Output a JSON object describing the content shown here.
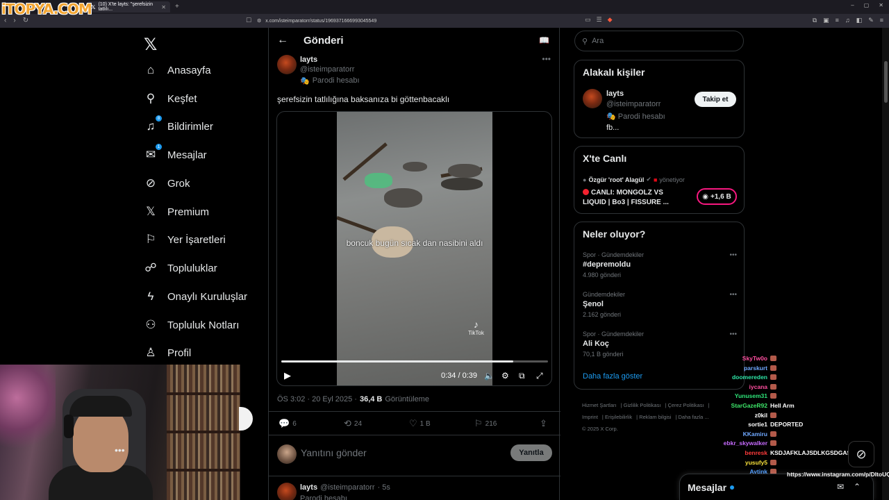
{
  "browser": {
    "logo_text": "iTOPYA.COM",
    "tab_title": "(10) X'te layts: \"şerefsizin tatlılı...",
    "url": "x.com/isteimparatorr/status/1969371666993045549"
  },
  "sidebar": {
    "items": [
      {
        "label": "Anasayfa",
        "icon": "home-icon"
      },
      {
        "label": "Keşfet",
        "icon": "search-icon"
      },
      {
        "label": "Bildirimler",
        "icon": "bell-icon",
        "badge": "8"
      },
      {
        "label": "Mesajlar",
        "icon": "mail-icon",
        "badge": "1"
      },
      {
        "label": "Grok",
        "icon": "grok-icon"
      },
      {
        "label": "Premium",
        "icon": "x-icon"
      },
      {
        "label": "Yer İşaretleri",
        "icon": "bookmark-icon"
      },
      {
        "label": "Topluluklar",
        "icon": "people-icon"
      },
      {
        "label": "Onaylı Kuruluşlar",
        "icon": "lightning-icon"
      },
      {
        "label": "Topluluk Notları",
        "icon": "notes-icon"
      },
      {
        "label": "Profil",
        "icon": "person-icon"
      }
    ]
  },
  "main": {
    "header_title": "Gönderi",
    "post": {
      "author": "layts",
      "handle": "@isteimparatorr",
      "parody": "Parodi hesabı",
      "text": "şerefsizin tatlılığına baksanıza bi göttenbacaklı",
      "video_caption": "boncuk bugün sıcak dan nasibini aldı",
      "tiktok_label": "TikTok",
      "time_current": "0:34",
      "time_total": "0:39",
      "progress": 0.87,
      "timestamp": "ÖS 3:02 · 20 Eyl 2025 ·",
      "views": "36,4 B",
      "views_label": "Görüntüleme",
      "replies": "6",
      "reposts": "24",
      "likes": "1 B",
      "bookmarks": "216"
    },
    "reply_placeholder": "Yanıtını gönder",
    "reply_button": "Yanıtla",
    "next_post": {
      "author": "layts",
      "handle": "@isteimparatorr",
      "time": "· 5s",
      "parody": "Parodi hesabı"
    }
  },
  "right": {
    "search_placeholder": "Ara",
    "related": {
      "title": "Alakalı kişiler",
      "name": "layts",
      "handle": "@isteimparatorr",
      "parody": "Parodi hesabı",
      "bio": "fb...",
      "follow": "Takip et"
    },
    "live": {
      "title": "X'te Canlı",
      "host": "Özgür 'root' Alagül",
      "host_suffix": "yönetiyor",
      "stream_title": "CANLI: MONGOLZ VS LIQUID | Bo3 | FISSURE ...",
      "count": "+1,6 B"
    },
    "trends": {
      "title": "Neler oluyor?",
      "items": [
        {
          "category": "Spor · Gündemdekiler",
          "name": "#depremoldu",
          "count": "4.980 gönderi"
        },
        {
          "category": "Gündemdekiler",
          "name": "Şenol",
          "count": "2.162 gönderi"
        },
        {
          "category": "Spor · Gündemdekiler",
          "name": "Ali Koç",
          "count": "70,1 B gönderi"
        }
      ],
      "show_more": "Daha fazla göster"
    },
    "footer": [
      "Hizmet Şartları",
      "Gizlilik Politikası",
      "Çerez Politikası",
      "Imprint",
      "Erişilebilirlik",
      "Reklam bilgisi",
      "Daha fazla ...",
      "© 2025 X Corp."
    ]
  },
  "chat": [
    {
      "user": "SkyTw0o",
      "color": "#ff4fa0",
      "msg": ""
    },
    {
      "user": "parskurt",
      "color": "#6fa8ff",
      "msg": ""
    },
    {
      "user": "doomereden",
      "color": "#2ee6a8",
      "msg": ""
    },
    {
      "user": "iycana",
      "color": "#ff4fa0",
      "msg": ""
    },
    {
      "user": "Yunusem31",
      "color": "#2ee67a",
      "msg": ""
    },
    {
      "user": "StarGazeR92",
      "color": "#3ee66a",
      "msg": "Hell Arm"
    },
    {
      "user": "z0kil",
      "color": "#ffffff",
      "msg": ""
    },
    {
      "user": "sortie1",
      "color": "#ffffff",
      "msg": "DEPORTED"
    },
    {
      "user": "KKamiru",
      "color": "#6fa8ff",
      "msg": ""
    },
    {
      "user": "ebkr_skywalker",
      "color": "#c76bff",
      "msg": ""
    },
    {
      "user": "benresk",
      "color": "#ff3b3b",
      "msg": "KSDJAFKLAJSDLKGSDGASD"
    },
    {
      "user": "yusufy5",
      "color": "#f7e03a",
      "msg": ""
    },
    {
      "user": "Aytink",
      "color": "#4f9dff",
      "msg": ""
    },
    {
      "user": "SkyTw0o",
      "color": "#ff4fa0",
      "msg": ""
    }
  ],
  "chat_link": "https://www.instagram.com/p/DItoUQh/",
  "messages_drawer": {
    "title": "Mesajlar"
  }
}
